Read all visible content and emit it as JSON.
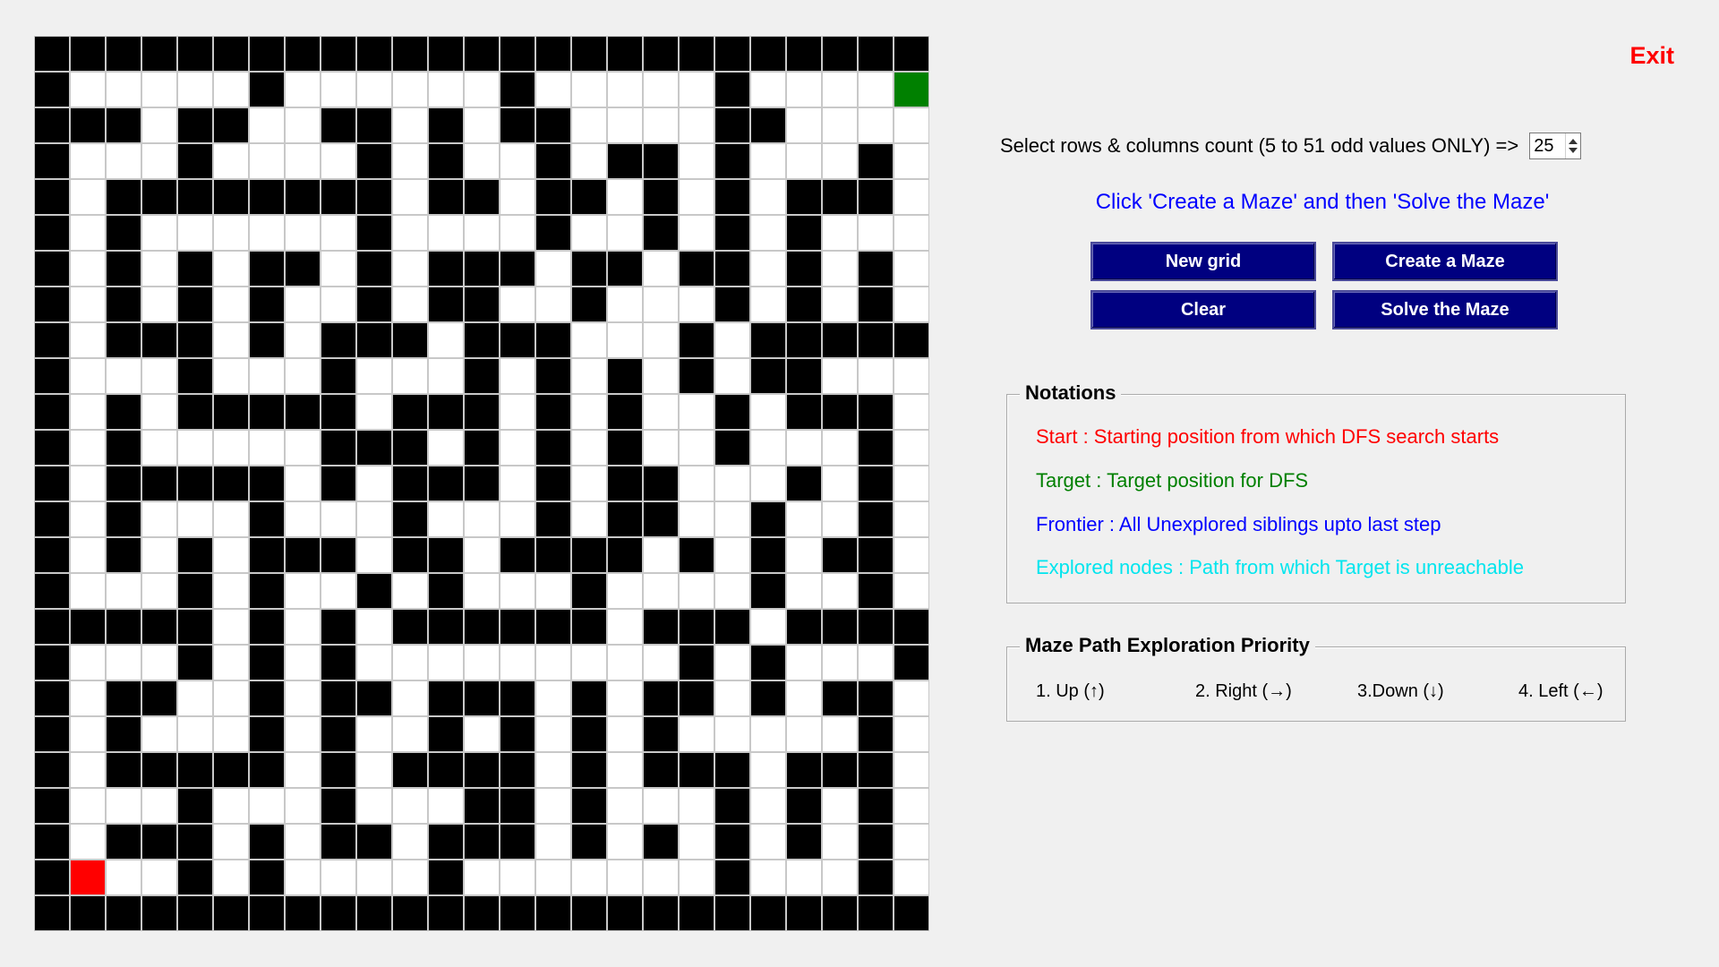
{
  "maze": {
    "size": 25,
    "rows": [
      "1111111111111111111111111",
      "1000001000000100000100002",
      "1110110011010110000110000",
      "1000100001010010110100010",
      "1011111111011011010101110",
      "1010000001000010010101000",
      "1010101101011101101101010",
      "1010101001011001000101010",
      "1011101011101110001011111",
      "1000100010001010101011000",
      "1010111110111010100101110",
      "1010000011101010100100010",
      "1011111010111010110001010",
      "1010001000100010110010010",
      "1010101110110111101010110",
      "1000101001010001000010010",
      "1111101010111111011101111",
      "1000101010000000001010001",
      "1011001011011101011010110",
      "1010001010010101010000010",
      "1011111010111101011101110",
      "1000100010001101000101010",
      "1011101011011101010101010",
      "1300101000010000000100010",
      "1111111111111111111111111"
    ],
    "start_color": "#ff0000",
    "target_color": "#008000",
    "wall_color": "#000000",
    "open_color": "#ffffff"
  },
  "header": {
    "exit_label": "Exit"
  },
  "controls": {
    "size_label": "Select rows & columns count (5 to 51 odd values ONLY) =>",
    "size_value": "25",
    "instruction": "Click 'Create a Maze' and then 'Solve the Maze'",
    "new_grid_label": "New grid",
    "create_maze_label": "Create a Maze",
    "clear_label": "Clear",
    "solve_maze_label": "Solve the Maze",
    "button_color": "#000080"
  },
  "notations": {
    "title": "Notations",
    "start": "Start : Starting position from which DFS search starts",
    "target": "Target : Target position for DFS",
    "frontier": "Frontier : All Unexplored siblings upto last step",
    "explored": "Explored nodes : Path from which Target is unreachable",
    "start_color": "#ff0000",
    "target_color": "#008000",
    "frontier_color": "#0000ff",
    "explored_color": "#00e5ee"
  },
  "priority": {
    "title": "Maze Path Exploration Priority",
    "up": "1. Up (↑)",
    "right": "2. Right (→)",
    "down": "3.Down (↓)",
    "left": "4. Left (←)"
  }
}
